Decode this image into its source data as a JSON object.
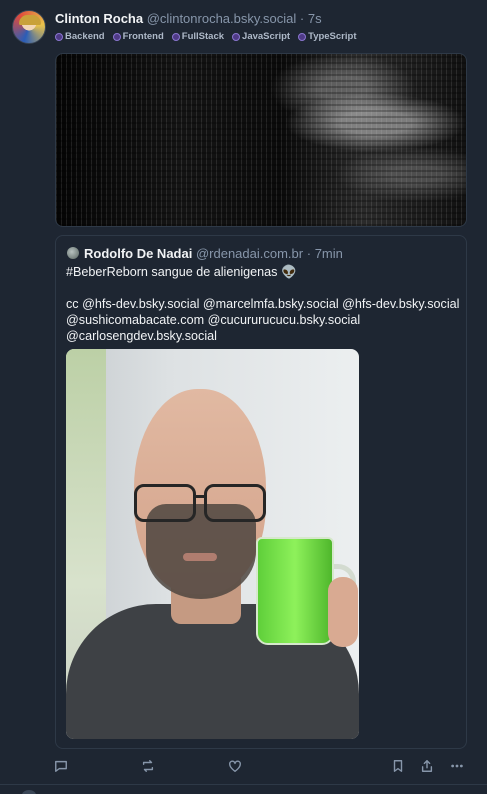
{
  "post": {
    "author": {
      "name": "Clinton Rocha",
      "handle": "@clintonrocha.bsky.social",
      "separator": "·",
      "time": "7s"
    },
    "tags": [
      {
        "label": "Backend"
      },
      {
        "label": "Frontend"
      },
      {
        "label": "FullStack"
      },
      {
        "label": "JavaScript"
      },
      {
        "label": "TypeScript"
      }
    ],
    "quote": {
      "author": {
        "name": "Rodolfo De Nadai",
        "handle": "@rdenadai.com.br",
        "separator": "·",
        "time": "7min"
      },
      "text_line1": "#BeberReborn sangue de alienigenas 👽",
      "text_cc": "cc @hfs-dev.bsky.social @marcelmfa.bsky.social @hfs-dev.bsky.social @sushicomabacate.com @cucururucucu.bsky.social @carlosengdev.bsky.social"
    },
    "actions": [
      {
        "icon": "reply-icon"
      },
      {
        "icon": "repost-icon"
      },
      {
        "icon": "like-icon"
      },
      {
        "icon": "bookmark-icon"
      },
      {
        "icon": "share-icon"
      },
      {
        "icon": "more-icon"
      }
    ]
  }
}
